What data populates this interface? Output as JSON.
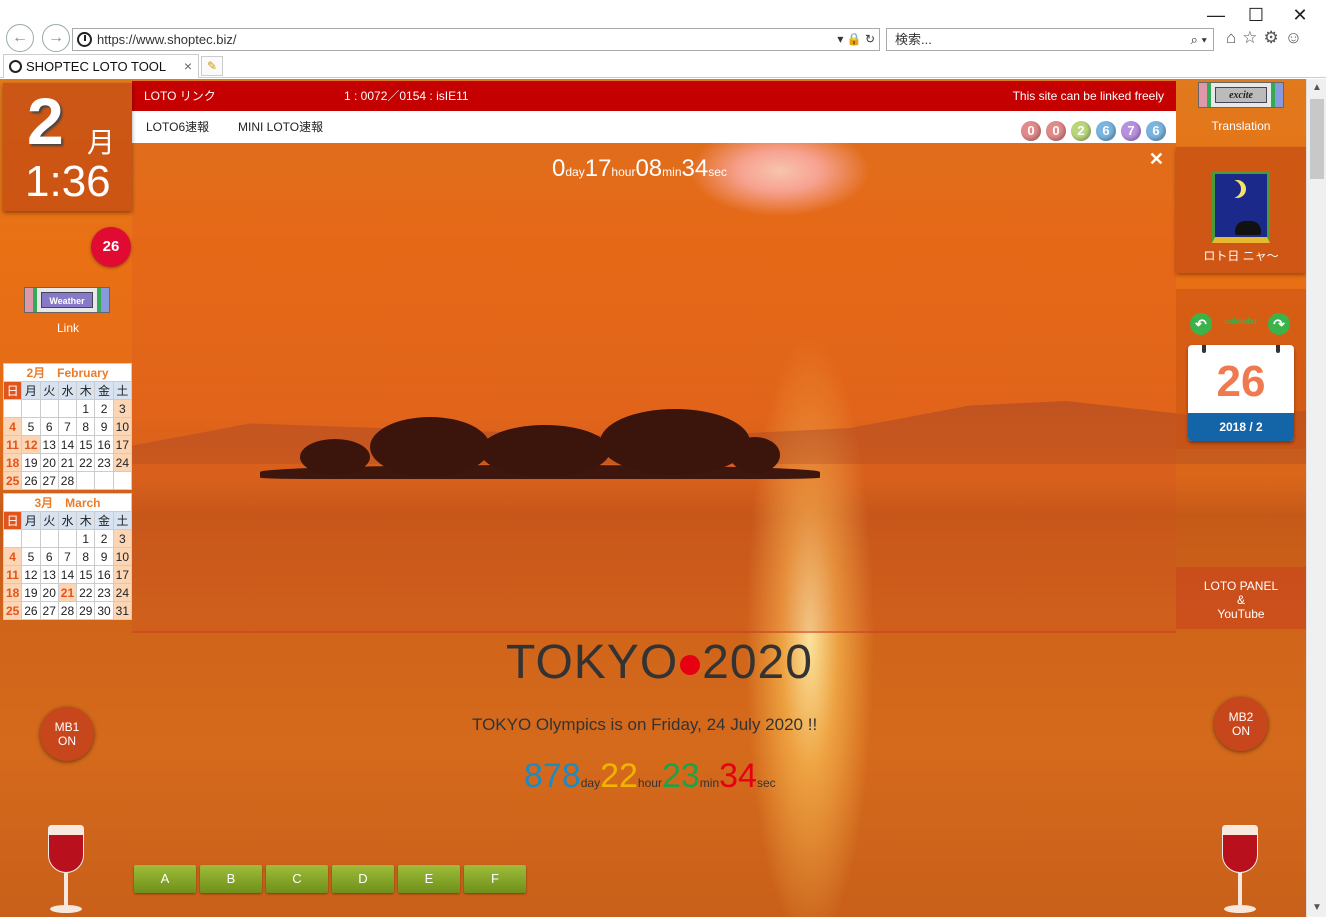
{
  "browser": {
    "url": "https://www.shoptec.biz/",
    "search_placeholder": "検索...",
    "tab_title": "SHOPTEC LOTO TOOL",
    "win_min": "—",
    "win_max": "☐",
    "win_close": "✕",
    "back": "←",
    "forward": "→",
    "address_tools": "▾ 🔒 ↻",
    "search_tools": "⌕ ▾",
    "right_icons": "⌂☆⚙☺",
    "tab_close": "×",
    "newtab": "✎"
  },
  "left": {
    "month_num": "2",
    "month_unit": "月",
    "time": "1:36",
    "day_badge": "26",
    "weather_label": "Weather",
    "link_label": "Link",
    "calendars": [
      {
        "header": "2月　February",
        "weekdays": [
          "日",
          "月",
          "火",
          "水",
          "木",
          "金",
          "土"
        ],
        "weeks": [
          [
            "",
            "",
            "",
            "",
            "1",
            "2",
            "3"
          ],
          [
            "4",
            "5",
            "6",
            "7",
            "8",
            "9",
            "10"
          ],
          [
            "11",
            "12",
            "13",
            "14",
            "15",
            "16",
            "17"
          ],
          [
            "18",
            "19",
            "20",
            "21",
            "22",
            "23",
            "24"
          ],
          [
            "25",
            "26",
            "27",
            "28",
            "",
            "",
            ""
          ]
        ]
      },
      {
        "header": "3月　March",
        "weekdays": [
          "日",
          "月",
          "火",
          "水",
          "木",
          "金",
          "土"
        ],
        "weeks": [
          [
            "",
            "",
            "",
            "",
            "1",
            "2",
            "3"
          ],
          [
            "4",
            "5",
            "6",
            "7",
            "8",
            "9",
            "10"
          ],
          [
            "11",
            "12",
            "13",
            "14",
            "15",
            "16",
            "17"
          ],
          [
            "18",
            "19",
            "20",
            "21",
            "22",
            "23",
            "24"
          ],
          [
            "25",
            "26",
            "27",
            "28",
            "29",
            "30",
            "31"
          ]
        ]
      }
    ],
    "mb1_line1": "MB1",
    "mb1_line2": "ON"
  },
  "top": {
    "link_title": "LOTO リンク",
    "counter": "1 : 0072／0154 : isIE11",
    "freely": "This site can be linked freely",
    "menu1": "LOTO6速報",
    "menu2": "MINI LOTO速報",
    "balls": [
      {
        "n": "0",
        "color": "#e08a8a"
      },
      {
        "n": "0",
        "color": "#e08a8a"
      },
      {
        "n": "2",
        "color": "#b9d67a"
      },
      {
        "n": "6",
        "color": "#7ab4e0"
      },
      {
        "n": "7",
        "color": "#b890e0"
      },
      {
        "n": "6",
        "color": "#7ab4e0"
      }
    ]
  },
  "countdown1": {
    "day": "0",
    "day_unit": "day",
    "hour": "17",
    "hour_unit": "hour",
    "min": "08",
    "min_unit": "min",
    "sec": "34",
    "sec_unit": "sec",
    "close": "✕"
  },
  "right": {
    "excite_label": "excite",
    "translation": "Translation",
    "cat_label": "ロト日 ニャ〜",
    "prev_arrow": "↶",
    "next_arrow": "↷",
    "cal_label": "calendar",
    "date_num": "26",
    "date_ym": "2018 / 2",
    "panel_line1": "LOTO PANEL",
    "panel_line2": "&",
    "panel_line3": "YouTube",
    "mb2_line1": "MB2",
    "mb2_line2": "ON"
  },
  "tokyo": {
    "title_left": "TOKYO",
    "title_right": "2020",
    "subtitle": "TOKYO Olympics is on Friday, 24 July 2020 !!",
    "day": "878",
    "day_unit": "day",
    "hour": "22",
    "hour_unit": "hour",
    "min": "23",
    "min_unit": "min",
    "sec": "34",
    "sec_unit": "sec",
    "colors": {
      "day": "#1f8ac0",
      "hour": "#f0b400",
      "min": "#1aa34a",
      "sec": "#e60012"
    }
  },
  "bottom_buttons": [
    "A",
    "B",
    "C",
    "D",
    "E",
    "F"
  ],
  "scroll": {
    "up": "▲",
    "down": "▼"
  }
}
